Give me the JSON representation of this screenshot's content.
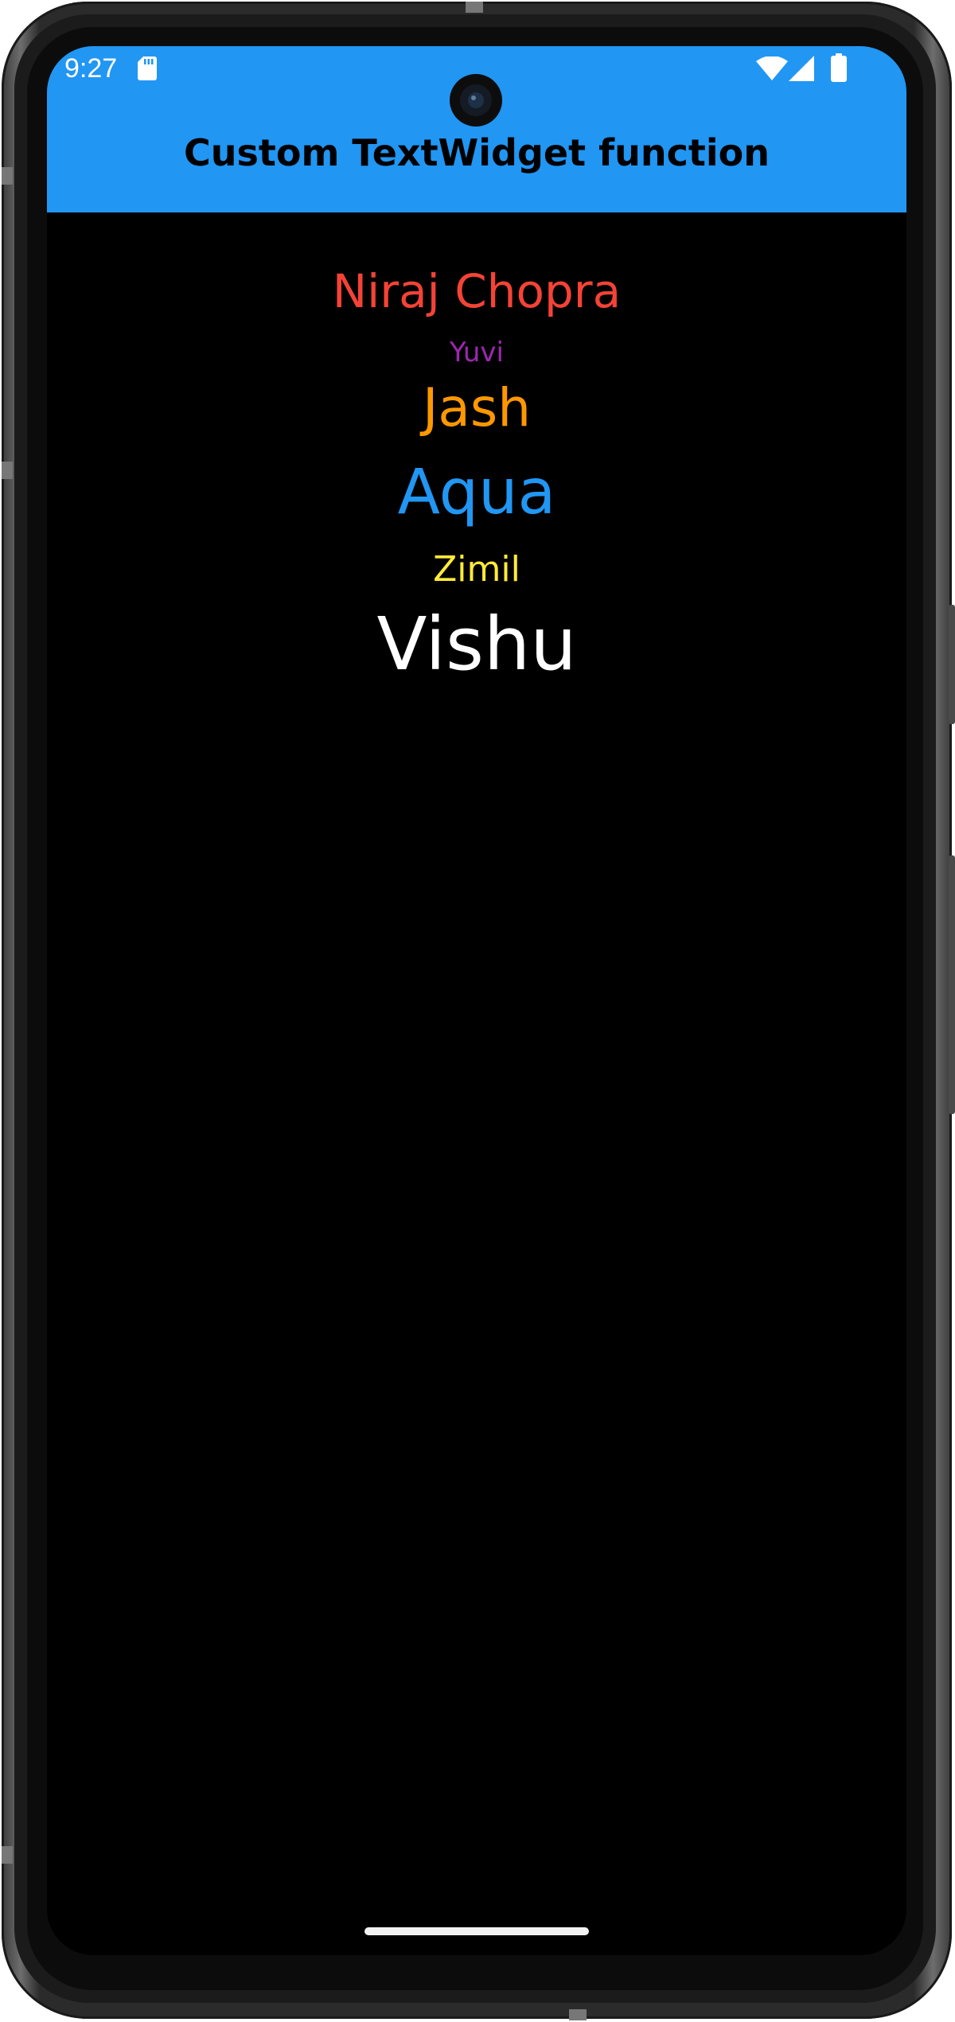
{
  "colors": {
    "app_bar": "#2196f3",
    "screen_background": "#000000",
    "title_text": "#000000",
    "home_indicator": "#f2f2f2"
  },
  "status_bar": {
    "time": "9:27",
    "icons": [
      "sd-card-icon",
      "wifi-icon",
      "signal-icon",
      "battery-icon"
    ]
  },
  "app_bar": {
    "title": "Custom TextWidget function"
  },
  "names": [
    {
      "text": "Niraj Chopra",
      "color": "#f44336"
    },
    {
      "text": "Yuvi",
      "color": "#9c27b0"
    },
    {
      "text": "Jash",
      "color": "#ff9800"
    },
    {
      "text": "Aqua",
      "color": "#2196f3"
    },
    {
      "text": "Zimil",
      "color": "#ffeb3b"
    },
    {
      "text": "Vishu",
      "color": "#ffffff"
    }
  ]
}
